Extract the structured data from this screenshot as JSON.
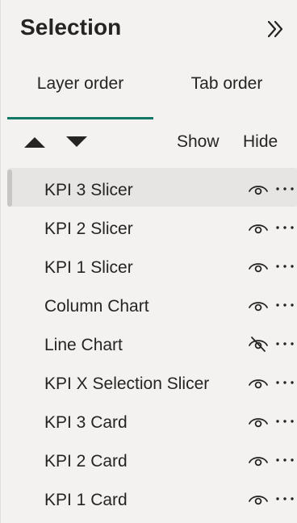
{
  "pane": {
    "title": "Selection",
    "collapse_icon": "chevron-double-right-icon"
  },
  "tabs": {
    "layer_order": "Layer order",
    "tab_order": "Tab order",
    "active": "Layer order"
  },
  "toolbar": {
    "move_up_icon": "triangle-up-icon",
    "move_down_icon": "triangle-down-icon",
    "show_label": "Show",
    "hide_label": "Hide"
  },
  "layers": [
    {
      "label": "KPI 3 Slicer",
      "visible": true,
      "selected": true
    },
    {
      "label": "KPI 2 Slicer",
      "visible": true,
      "selected": false
    },
    {
      "label": "KPI 1 Slicer",
      "visible": true,
      "selected": false
    },
    {
      "label": "Column Chart",
      "visible": true,
      "selected": false
    },
    {
      "label": "Line Chart",
      "visible": false,
      "selected": false
    },
    {
      "label": "KPI X Selection Slicer",
      "visible": true,
      "selected": false
    },
    {
      "label": "KPI 3 Card",
      "visible": true,
      "selected": false
    },
    {
      "label": "KPI 2 Card",
      "visible": true,
      "selected": false
    },
    {
      "label": "KPI 1 Card",
      "visible": true,
      "selected": false
    }
  ],
  "colors": {
    "pane_background": "#f3f2f1",
    "selected_row": "#e6e5e3",
    "selected_marker": "#c8c6c4",
    "tab_indicator": "#117865",
    "text": "#252423"
  }
}
